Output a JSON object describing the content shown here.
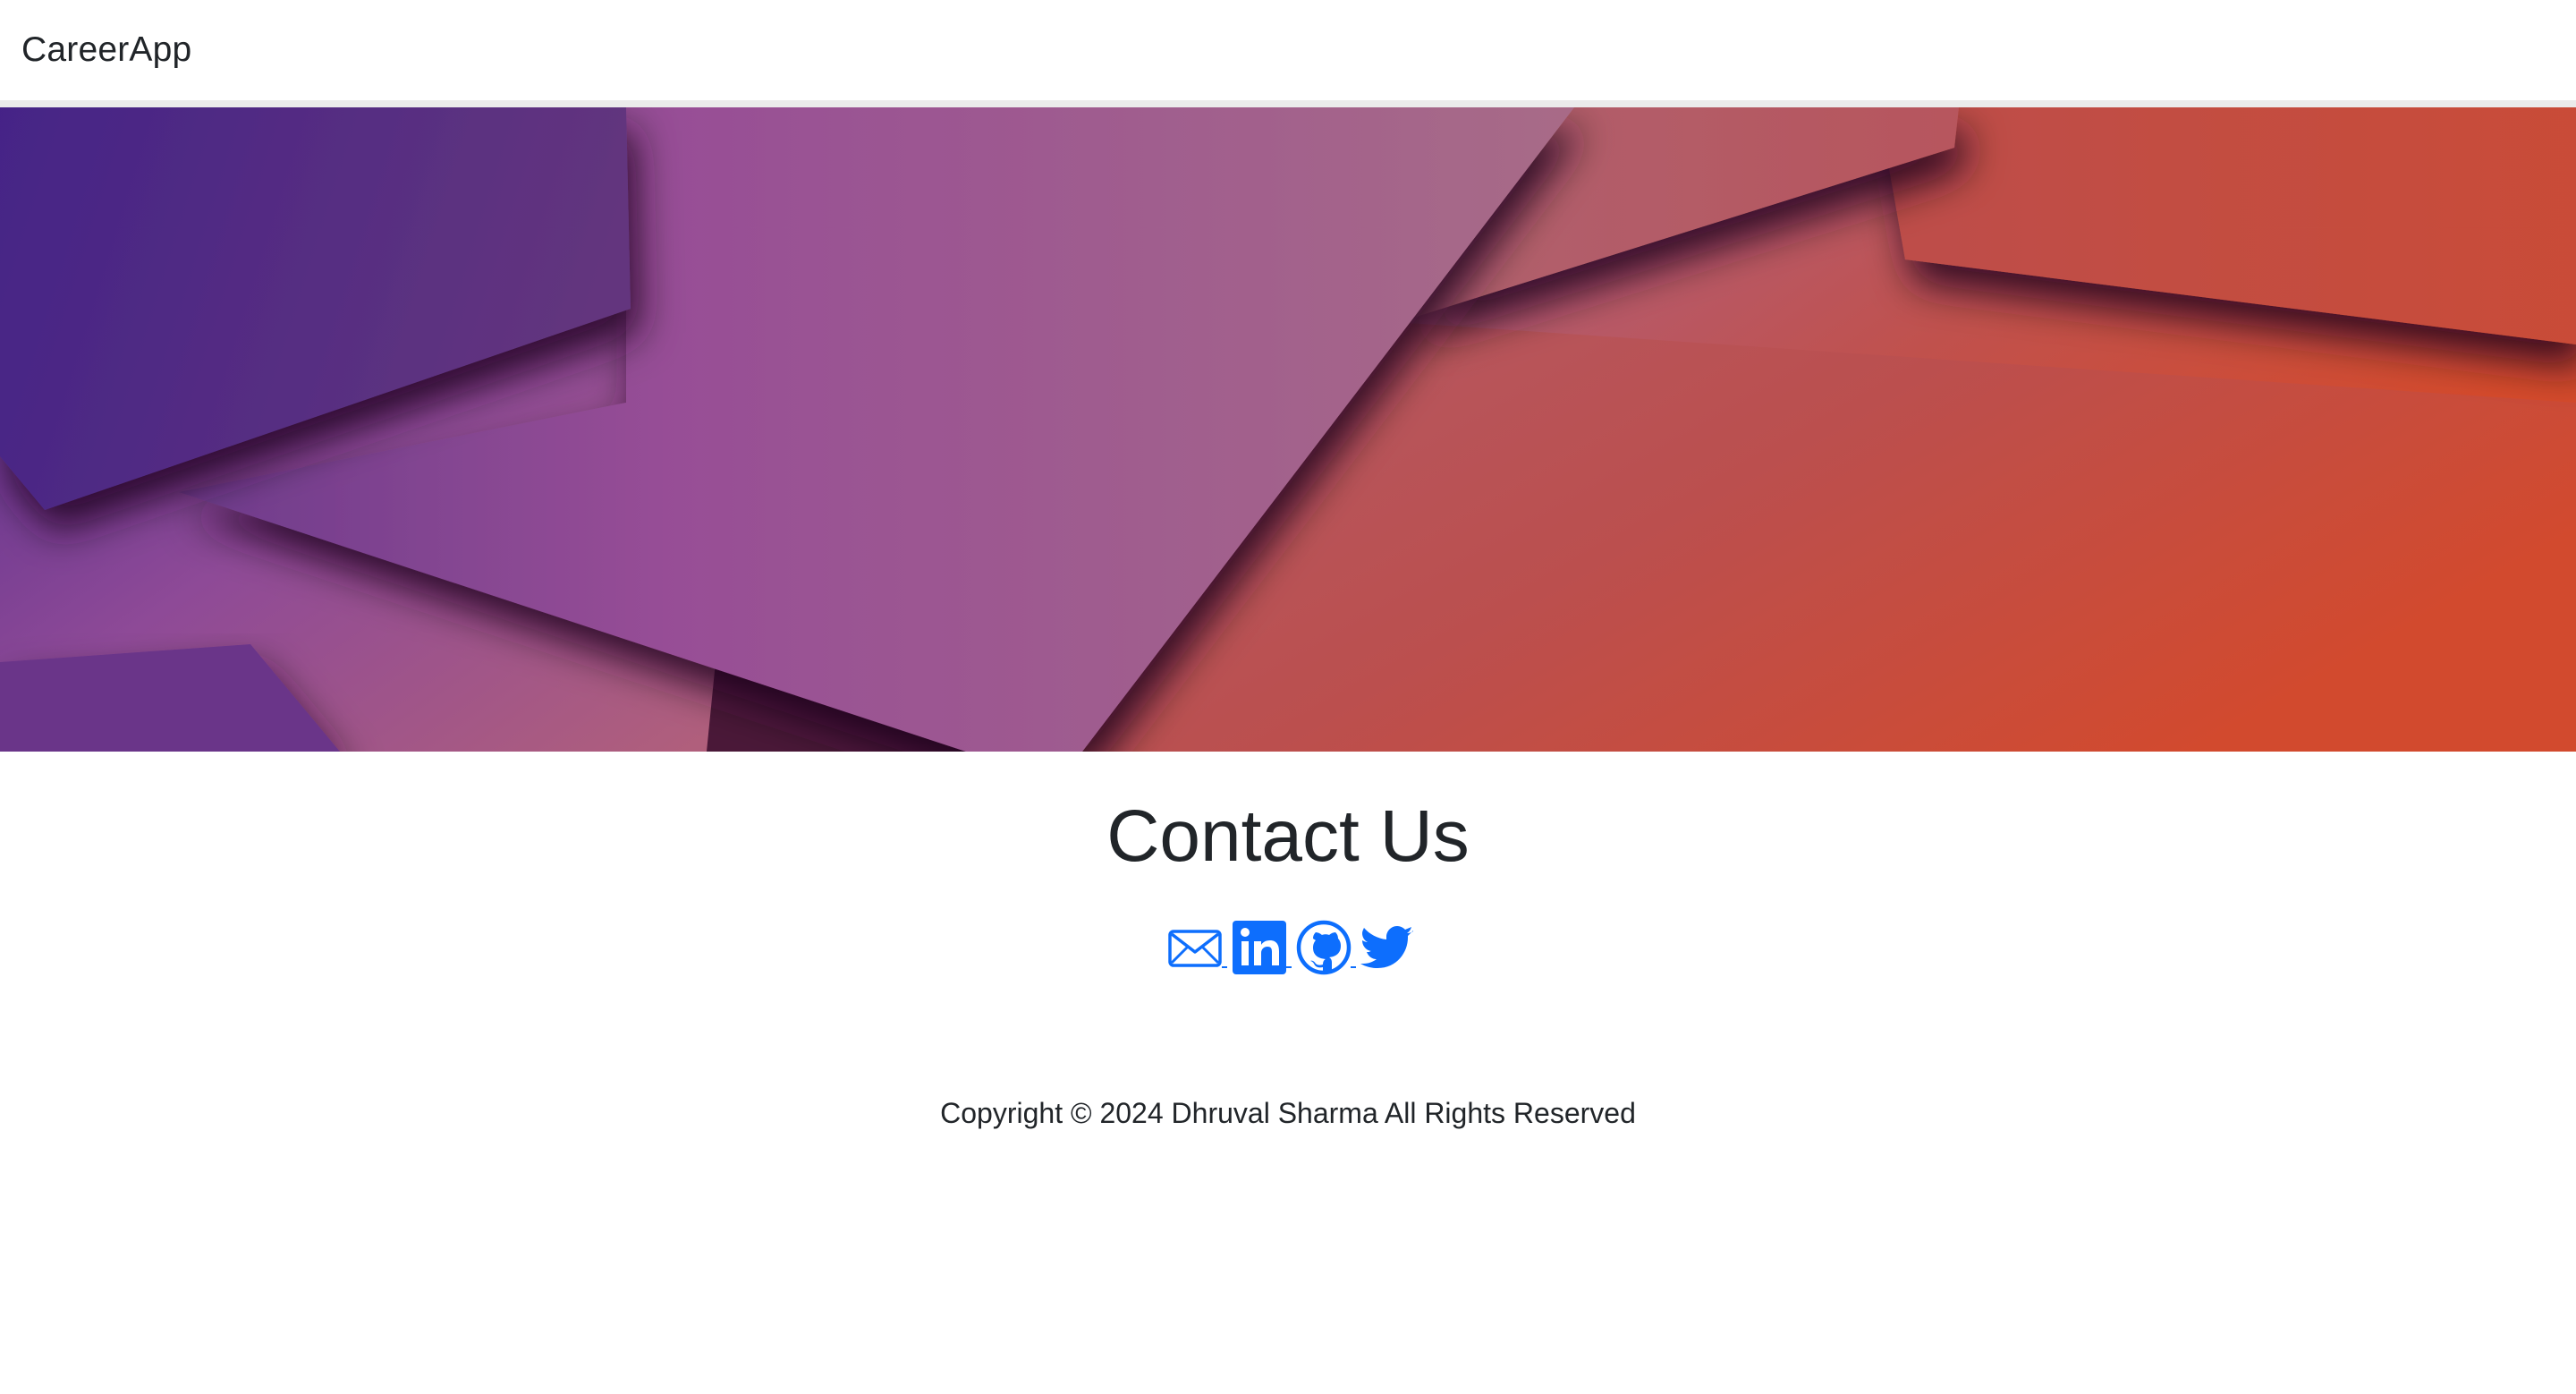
{
  "navbar": {
    "brand": "CareerApp"
  },
  "hero": {
    "image": "abstract-gradient-background",
    "colors": {
      "purple": "#4a2586",
      "magenta": "#9a5095",
      "pink": "#b55c68",
      "orange": "#d04a30"
    }
  },
  "contact": {
    "title": "Contact Us",
    "icons": [
      "envelope-icon",
      "linkedin-icon",
      "github-icon",
      "twitter-icon"
    ],
    "icon_color": "#0d6efd"
  },
  "footer": {
    "copyright": "Copyright © 2024 Dhruval Sharma All Rights Reserved"
  }
}
